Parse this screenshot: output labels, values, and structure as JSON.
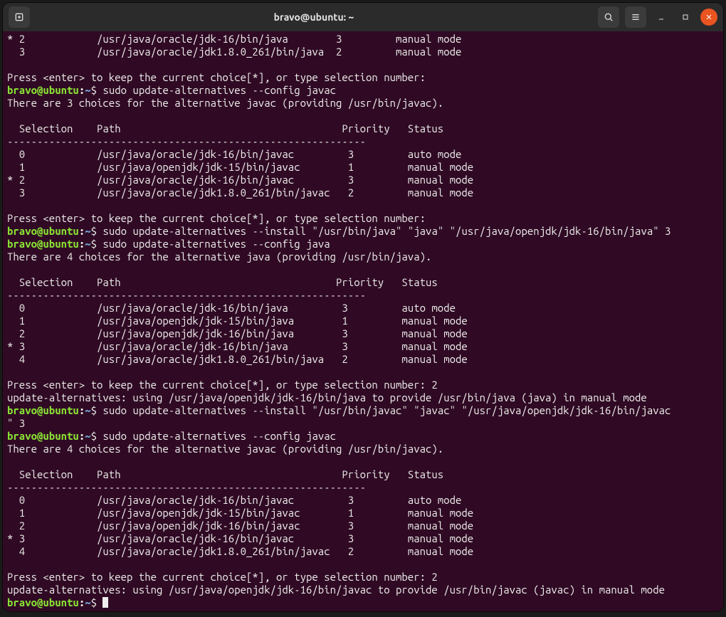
{
  "titlebar": {
    "title": "bravo@ubuntu: ~"
  },
  "prompt": {
    "user_host": "bravo@ubuntu",
    "colon": ":",
    "path": "~",
    "dollar": "$ "
  },
  "lines": {
    "l00": "* 2            /usr/java/oracle/jdk-16/bin/java        3         manual mode",
    "l01": "  3            /usr/java/oracle/jdk1.8.0_261/bin/java  2         manual mode",
    "l02": "",
    "l03": "Press <enter> to keep the current choice[*], or type selection number: ",
    "cmd1": "sudo update-alternatives --config javac",
    "l05": "There are 3 choices for the alternative javac (providing /usr/bin/javac).",
    "l06": "",
    "l07": "  Selection    Path                                     Priority   Status",
    "l08": "------------------------------------------------------------",
    "l09": "  0            /usr/java/oracle/jdk-16/bin/javac         3         auto mode",
    "l10": "  1            /usr/java/openjdk/jdk-15/bin/javac        1         manual mode",
    "l11": "* 2            /usr/java/oracle/jdk-16/bin/javac         3         manual mode",
    "l12": "  3            /usr/java/oracle/jdk1.8.0_261/bin/javac   2         manual mode",
    "l13": "",
    "l14": "Press <enter> to keep the current choice[*], or type selection number: ",
    "cmd2": "sudo update-alternatives --install \"/usr/bin/java\" \"java\" \"/usr/java/openjdk/jdk-16/bin/java\" 3",
    "cmd3": "sudo update-alternatives --config java",
    "l17": "There are 4 choices for the alternative java (providing /usr/bin/java).",
    "l18": "",
    "l19": "  Selection    Path                                    Priority   Status",
    "l20": "------------------------------------------------------------",
    "l21": "  0            /usr/java/oracle/jdk-16/bin/java         3         auto mode",
    "l22": "  1            /usr/java/openjdk/jdk-15/bin/java        1         manual mode",
    "l23": "  2            /usr/java/openjdk/jdk-16/bin/java        3         manual mode",
    "l24": "* 3            /usr/java/oracle/jdk-16/bin/java         3         manual mode",
    "l25": "  4            /usr/java/oracle/jdk1.8.0_261/bin/java   2         manual mode",
    "l26": "",
    "l27": "Press <enter> to keep the current choice[*], or type selection number: 2",
    "l28": "update-alternatives: using /usr/java/openjdk/jdk-16/bin/java to provide /usr/bin/java (java) in manual mode",
    "cmd4a": "sudo update-alternatives --install \"/usr/bin/javac\" \"javac\" \"/usr/java/openjdk/jdk-16/bin/javac",
    "cmd4b": "\" 3",
    "cmd5": "sudo update-alternatives --config javac",
    "l32": "There are 4 choices for the alternative javac (providing /usr/bin/javac).",
    "l33": "",
    "l34": "  Selection    Path                                     Priority   Status",
    "l35": "------------------------------------------------------------",
    "l36": "  0            /usr/java/oracle/jdk-16/bin/javac         3         auto mode",
    "l37": "  1            /usr/java/openjdk/jdk-15/bin/javac        1         manual mode",
    "l38": "  2            /usr/java/openjdk/jdk-16/bin/javac        3         manual mode",
    "l39": "* 3            /usr/java/oracle/jdk-16/bin/javac         3         manual mode",
    "l40": "  4            /usr/java/oracle/jdk1.8.0_261/bin/javac   2         manual mode",
    "l41": "",
    "l42": "Press <enter> to keep the current choice[*], or type selection number: 2",
    "l43": "update-alternatives: using /usr/java/openjdk/jdk-16/bin/javac to provide /usr/bin/javac (javac) in manual mode"
  }
}
